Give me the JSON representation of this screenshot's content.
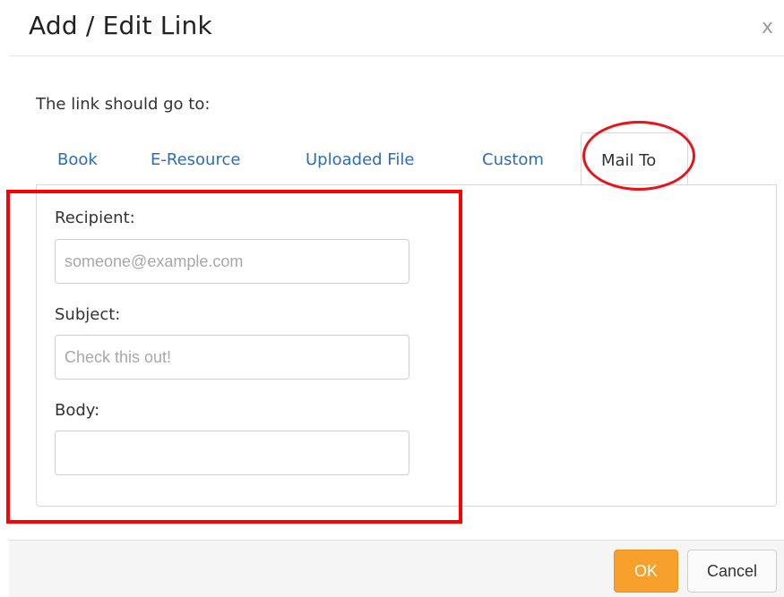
{
  "dialog": {
    "title": "Add / Edit Link",
    "close_label": "x"
  },
  "intro_text": "The link should go to:",
  "tabs": [
    {
      "label": "Book",
      "active": false
    },
    {
      "label": "E-Resource",
      "active": false
    },
    {
      "label": "Uploaded File",
      "active": false
    },
    {
      "label": "Custom",
      "active": false
    },
    {
      "label": "Mail To",
      "active": true
    }
  ],
  "form": {
    "recipient": {
      "label": "Recipient:",
      "value": "",
      "placeholder": "someone@example.com"
    },
    "subject": {
      "label": "Subject:",
      "value": "",
      "placeholder": "Check this out!"
    },
    "body": {
      "label": "Body:",
      "value": "",
      "placeholder": ""
    }
  },
  "footer": {
    "ok_label": "OK",
    "cancel_label": "Cancel"
  },
  "colors": {
    "link": "#2a6ebb",
    "ok_button": "#f7a12c",
    "annotation": "#ff0000"
  }
}
